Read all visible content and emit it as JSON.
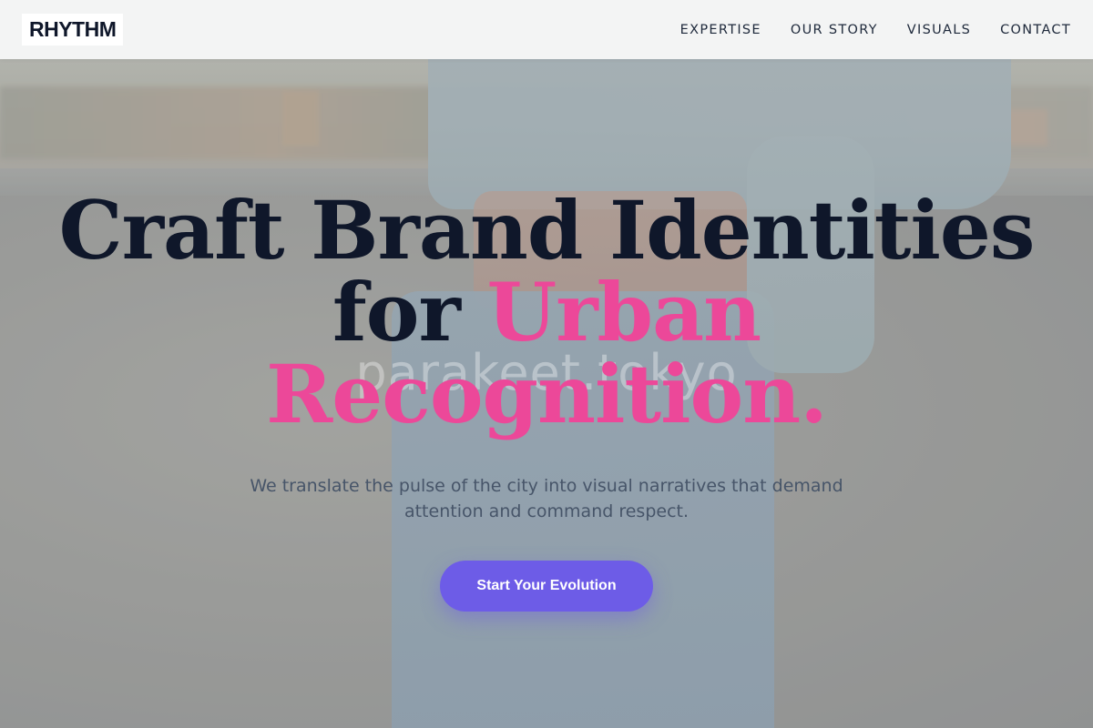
{
  "header": {
    "logo": "RHYTHM",
    "nav": [
      "EXPERTISE",
      "OUR STORY",
      "VISUALS",
      "CONTACT"
    ]
  },
  "hero": {
    "title_line1": "Craft Brand Identities",
    "title_line2_plain": "for",
    "title_line2_accent": "Urban",
    "title_line3_accent": "Recognition.",
    "subtitle": "We translate the pulse of the city into visual narratives that demand attention and command respect.",
    "cta_label": "Start Your Evolution"
  },
  "background": {
    "watermark": "parakeet.tokyo"
  },
  "colors": {
    "accent": "#ec4899",
    "primary_button": "#6d5ce7",
    "heading": "#0f172a",
    "body_text": "#475569"
  }
}
